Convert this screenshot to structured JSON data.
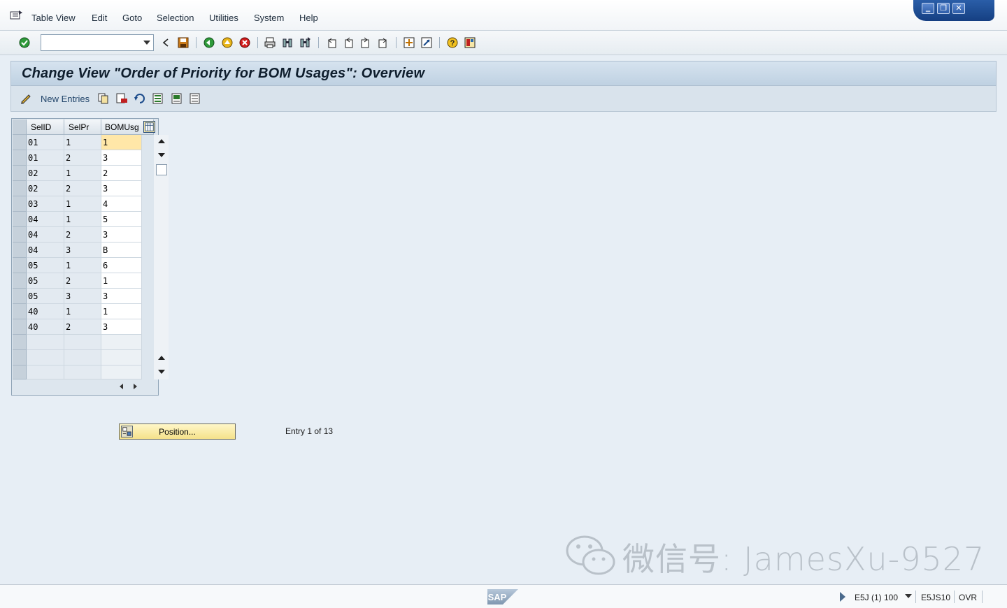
{
  "menubar": {
    "items": [
      {
        "label": "Table View"
      },
      {
        "label": "Edit"
      },
      {
        "label": "Goto"
      },
      {
        "label": "Selection"
      },
      {
        "label": "Utilities"
      },
      {
        "label": "System"
      },
      {
        "label": "Help"
      }
    ]
  },
  "window_controls": {
    "minimize": "‗",
    "restore": "❐",
    "close": "✕"
  },
  "toolbar": {
    "command_field_value": "",
    "icons": [
      "enter-icon",
      "back-icon",
      "save-icon",
      "back-green-icon",
      "exit-icon",
      "cancel-icon",
      "print-icon",
      "find-icon",
      "find-next-icon",
      "first-page-icon",
      "previous-page-icon",
      "next-page-icon",
      "last-page-icon",
      "create-session-icon",
      "shortcut-icon",
      "help-icon",
      "layout-icon"
    ]
  },
  "title": "Change View \"Order of Priority for BOM Usages\": Overview",
  "app_toolbar": {
    "new_entries_label": "New Entries"
  },
  "table": {
    "columns": [
      "SelID",
      "SelPr",
      "BOMUsg"
    ],
    "rows": [
      [
        "01",
        "1",
        "1"
      ],
      [
        "01",
        "2",
        "3"
      ],
      [
        "02",
        "1",
        "2"
      ],
      [
        "02",
        "2",
        "3"
      ],
      [
        "03",
        "1",
        "4"
      ],
      [
        "04",
        "1",
        "5"
      ],
      [
        "04",
        "2",
        "3"
      ],
      [
        "04",
        "3",
        "B"
      ],
      [
        "05",
        "1",
        "6"
      ],
      [
        "05",
        "2",
        "1"
      ],
      [
        "05",
        "3",
        "3"
      ],
      [
        "40",
        "1",
        "1"
      ],
      [
        "40",
        "2",
        "3"
      ]
    ],
    "empty_rows": 3
  },
  "position_button_label": "Position...",
  "entry_info": "Entry 1 of 13",
  "statusbar": {
    "logo": "SAP",
    "system": "E5J (1) 100",
    "server": "E5JS10",
    "mode": "OVR"
  },
  "watermark": "微信号: JamesXu-9527",
  "colors": {
    "background": "#e7eef5",
    "title_bar": "#c8d8e7",
    "active_cell": "#ffe7a8",
    "button_yellow": "#f5e28a"
  }
}
